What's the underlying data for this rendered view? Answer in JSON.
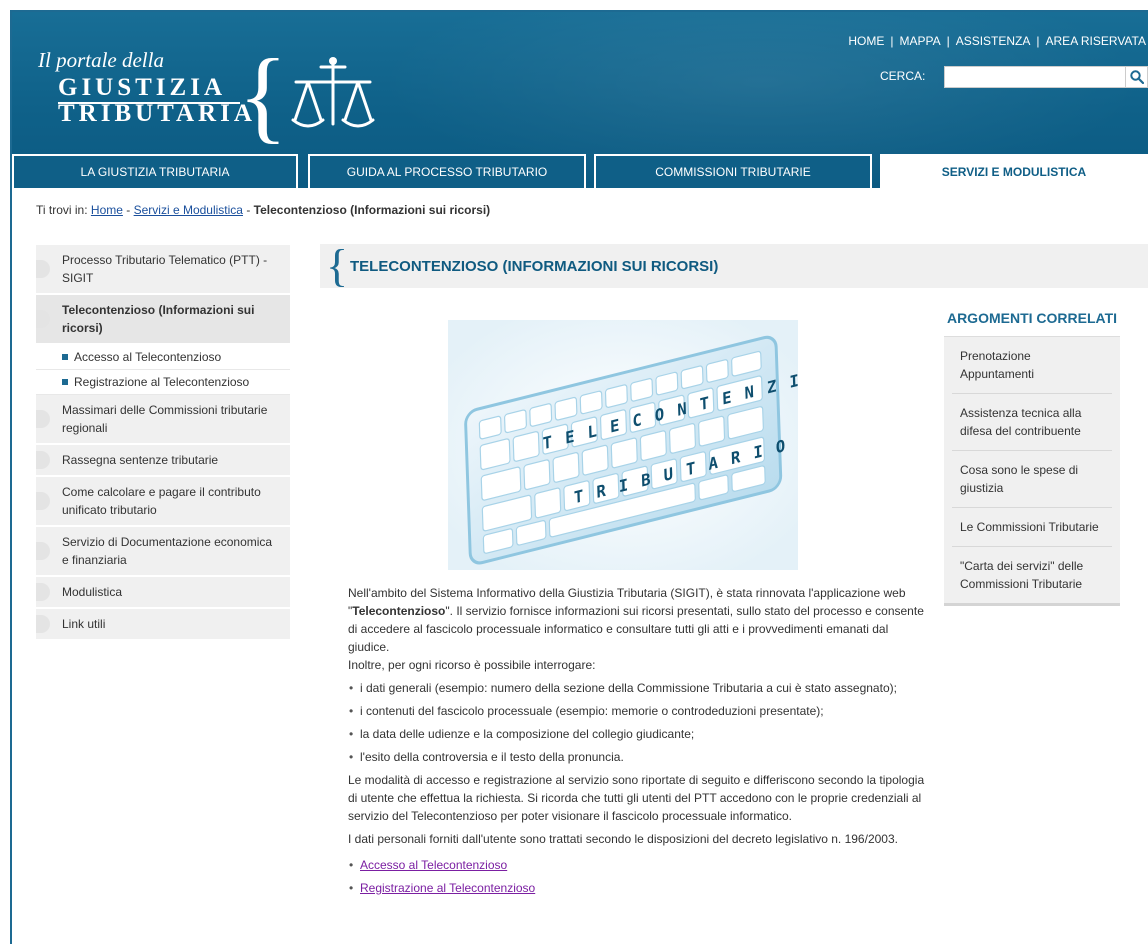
{
  "header": {
    "logo_pre": "Il portale della",
    "logo_line1": "GIUSTIZIA",
    "logo_line2": "TRIBUTARIA",
    "top_links": [
      "HOME",
      "MAPPA",
      "ASSISTENZA",
      "AREA RISERVATA"
    ],
    "search_label": "CERCA:",
    "search_value": "",
    "search_icon": "search-icon"
  },
  "tabs": [
    {
      "label": "LA GIUSTIZIA TRIBUTARIA",
      "active": false
    },
    {
      "label": "GUIDA AL PROCESSO TRIBUTARIO",
      "active": false
    },
    {
      "label": "COMMISSIONI TRIBUTARIE",
      "active": false
    },
    {
      "label": "SERVIZI E MODULISTICA",
      "active": true
    }
  ],
  "breadcrumb": {
    "prefix": "Ti trovi in:",
    "home": "Home",
    "section": "Servizi e Modulistica",
    "current": "Telecontenzioso (Informazioni sui ricorsi)"
  },
  "sidebar": {
    "items": [
      {
        "label": "Processo Tributario Telematico (PTT) - SIGIT"
      },
      {
        "label": "Telecontenzioso (Informazioni sui ricorsi)",
        "active": true,
        "sub": [
          "Accesso al Telecontenzioso",
          "Registrazione al Telecontenzioso"
        ]
      },
      {
        "label": "Massimari delle Commissioni tributarie regionali"
      },
      {
        "label": "Rassegna sentenze tributarie"
      },
      {
        "label": "Come calcolare e pagare il contributo unificato tributario"
      },
      {
        "label": "Servizio di Documentazione economica e finanziaria"
      },
      {
        "label": "Modulistica"
      },
      {
        "label": "Link utili"
      }
    ]
  },
  "main": {
    "title": "TELECONTENZIOSO (INFORMAZIONI SUI RICORSI)",
    "hero": {
      "line1": "TELECONTENZIOSO",
      "line2": "TRIBUTARIO"
    },
    "intro_a": "Nell'ambito del Sistema Informativo della Giustizia Tributaria (SIGIT), è stata rinnovata l'applicazione web \"",
    "intro_bold": "Telecontenzioso",
    "intro_b": "\". Il servizio fornisce informazioni sui ricorsi presentati, sullo stato del processo e consente di accedere al fascicolo processuale informatico e consultare tutti gli atti e i provvedimenti emanati dal giudice.",
    "intro_c": "Inoltre, per ogni ricorso è possibile interrogare:",
    "bullets": [
      "i dati generali (esempio: numero della sezione della Commissione Tributaria a cui è stato assegnato);",
      "i contenuti del fascicolo processuale (esempio: memorie o controdeduzioni presentate);",
      "la data delle udienze e la composizione del collegio giudicante;",
      "l'esito della controversia e il testo della pronuncia."
    ],
    "para2": "Le modalità di accesso e registrazione al servizio sono riportate di seguito e differiscono secondo la tipologia di utente che effettua la richiesta. Si ricorda che tutti gli utenti del PTT accedono con le proprie credenziali al servizio del Telecontenzioso per poter visionare il fascicolo processuale informatico.",
    "para3": "I dati personali forniti dall'utente sono trattati secondo le disposizioni del decreto legislativo n. 196/2003.",
    "links": [
      "Accesso al Telecontenzioso",
      "Registrazione al Telecontenzioso"
    ]
  },
  "related": {
    "title": "ARGOMENTI CORRELATI",
    "items": [
      "Prenotazione Appuntamenti",
      "Assistenza tecnica alla difesa del contribuente",
      "Cosa sono le spese di giustizia",
      "Le Commissioni Tributarie",
      "\"Carta dei servizi\" delle Commissioni Tributarie"
    ]
  },
  "colors": {
    "header_blue": "#0f6189",
    "accent_blue": "#1d6a92",
    "link_visited": "#7b1fa2",
    "link_blue": "#1a4f9c"
  }
}
